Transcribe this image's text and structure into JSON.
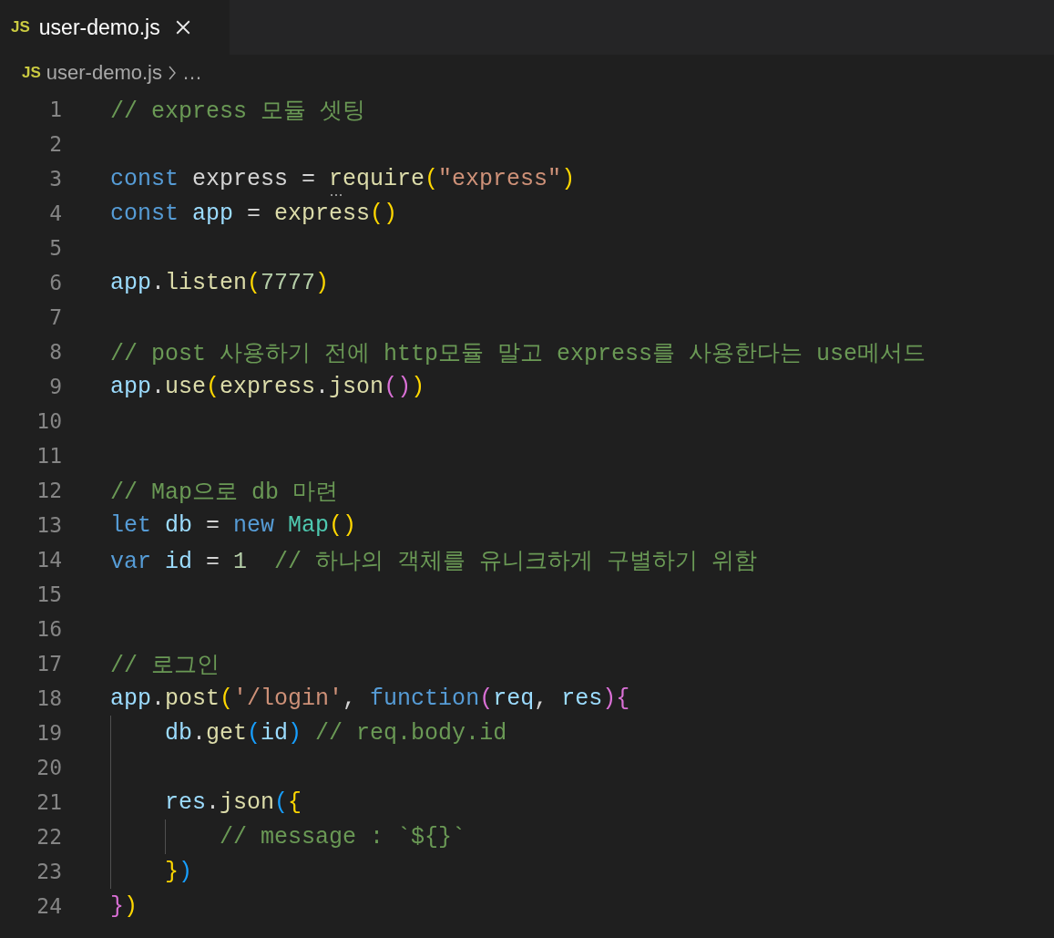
{
  "tabs": [
    {
      "icon": "JS",
      "label": "user-demo.js",
      "selected": true
    }
  ],
  "breadcrumb": {
    "icon": "JS",
    "file": "user-demo.js",
    "more": "…"
  },
  "lines": [
    {
      "number": "1",
      "tokens": [
        {
          "text": "// express 모듈 셋팅",
          "kind": "comment"
        }
      ]
    },
    {
      "number": "2"
    },
    {
      "number": "3",
      "tokens": [
        {
          "text": "const",
          "kind": "keyword"
        },
        {
          "text": " express = ",
          "kind": "plain"
        },
        {
          "text": "require",
          "kind": "function",
          "hint": true
        },
        {
          "text": "(",
          "kind": "bracket1"
        },
        {
          "text": "\"express\"",
          "kind": "string"
        },
        {
          "text": ")",
          "kind": "bracket1"
        }
      ]
    },
    {
      "number": "4",
      "tokens": [
        {
          "text": "const ",
          "kind": "keyword"
        },
        {
          "text": "app",
          "kind": "variable"
        },
        {
          "text": " = ",
          "kind": "plain"
        },
        {
          "text": "express",
          "kind": "function"
        },
        {
          "text": "()",
          "kind": "bracket1"
        }
      ]
    },
    {
      "number": "5"
    },
    {
      "number": "6",
      "tokens": [
        {
          "text": "app",
          "kind": "variable"
        },
        {
          "text": ".",
          "kind": "plain"
        },
        {
          "text": "listen",
          "kind": "function"
        },
        {
          "text": "(",
          "kind": "bracket1"
        },
        {
          "text": "7777",
          "kind": "number"
        },
        {
          "text": ")",
          "kind": "bracket1"
        }
      ]
    },
    {
      "number": "7"
    },
    {
      "number": "8",
      "tokens": [
        {
          "text": "// post 사용하기 전에 http모듈 말고 express를 사용한다는 use메서드",
          "kind": "comment"
        }
      ]
    },
    {
      "number": "9",
      "tokens": [
        {
          "text": "app",
          "kind": "variable"
        },
        {
          "text": ".",
          "kind": "plain"
        },
        {
          "text": "use",
          "kind": "function"
        },
        {
          "text": "(",
          "kind": "bracket1"
        },
        {
          "text": "express",
          "kind": "function"
        },
        {
          "text": ".",
          "kind": "plain"
        },
        {
          "text": "json",
          "kind": "function"
        },
        {
          "text": "()",
          "kind": "bracket2"
        },
        {
          "text": ")",
          "kind": "bracket1"
        }
      ]
    },
    {
      "number": "10"
    },
    {
      "number": "11"
    },
    {
      "number": "12",
      "tokens": [
        {
          "text": "// Map으로 db 마련",
          "kind": "comment"
        }
      ]
    },
    {
      "number": "13",
      "tokens": [
        {
          "text": "let ",
          "kind": "keyword"
        },
        {
          "text": "db",
          "kind": "variable"
        },
        {
          "text": " = ",
          "kind": "plain"
        },
        {
          "text": "new ",
          "kind": "keyword"
        },
        {
          "text": "Map",
          "kind": "class"
        },
        {
          "text": "()",
          "kind": "bracket1"
        }
      ]
    },
    {
      "number": "14",
      "tokens": [
        {
          "text": "var ",
          "kind": "keyword"
        },
        {
          "text": "id",
          "kind": "variable"
        },
        {
          "text": " = ",
          "kind": "plain"
        },
        {
          "text": "1",
          "kind": "number"
        },
        {
          "text": "  // 하나의 객체를 유니크하게 구별하기 위함",
          "kind": "comment"
        }
      ]
    },
    {
      "number": "15"
    },
    {
      "number": "16"
    },
    {
      "number": "17",
      "tokens": [
        {
          "text": "// 로그인",
          "kind": "comment"
        }
      ]
    },
    {
      "number": "18",
      "tokens": [
        {
          "text": "app",
          "kind": "variable"
        },
        {
          "text": ".",
          "kind": "plain"
        },
        {
          "text": "post",
          "kind": "function"
        },
        {
          "text": "(",
          "kind": "bracket1"
        },
        {
          "text": "'/login'",
          "kind": "string"
        },
        {
          "text": ", ",
          "kind": "plain"
        },
        {
          "text": "function",
          "kind": "keyword"
        },
        {
          "text": "(",
          "kind": "bracket2"
        },
        {
          "text": "req",
          "kind": "variable"
        },
        {
          "text": ", ",
          "kind": "plain"
        },
        {
          "text": "res",
          "kind": "variable"
        },
        {
          "text": ")",
          "kind": "bracket2"
        },
        {
          "text": "{",
          "kind": "bracket2"
        }
      ]
    },
    {
      "number": "19",
      "tokens": [
        {
          "text": "    db",
          "kind": "variable"
        },
        {
          "text": ".",
          "kind": "plain"
        },
        {
          "text": "get",
          "kind": "function"
        },
        {
          "text": "(",
          "kind": "bracket3"
        },
        {
          "text": "id",
          "kind": "variable"
        },
        {
          "text": ")",
          "kind": "bracket3"
        },
        {
          "text": " // req.body.id",
          "kind": "comment"
        }
      ]
    },
    {
      "number": "20"
    },
    {
      "number": "21",
      "tokens": [
        {
          "text": "    res",
          "kind": "variable"
        },
        {
          "text": ".",
          "kind": "plain"
        },
        {
          "text": "json",
          "kind": "function"
        },
        {
          "text": "(",
          "kind": "bracket3"
        },
        {
          "text": "{",
          "kind": "bracket1"
        }
      ]
    },
    {
      "number": "22",
      "tokens": [
        {
          "text": "        // message : `${}`",
          "kind": "comment"
        }
      ]
    },
    {
      "number": "23",
      "tokens": [
        {
          "text": "    }",
          "kind": "bracket1"
        },
        {
          "text": ")",
          "kind": "bracket3"
        }
      ]
    },
    {
      "number": "24",
      "tokens": [
        {
          "text": "}",
          "kind": "bracket2"
        },
        {
          "text": ")",
          "kind": "bracket1"
        }
      ]
    }
  ]
}
